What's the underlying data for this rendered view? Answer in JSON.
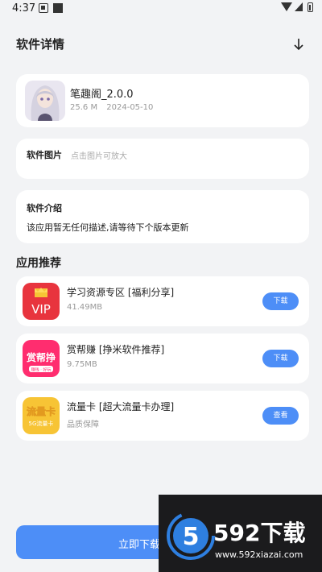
{
  "status_bar": {
    "time": "4:37"
  },
  "header": {
    "title": "软件详情",
    "download_icon": "download-arrow-icon"
  },
  "app": {
    "name": "笔趣阁_2.0.0",
    "size": "25.6 M",
    "date": "2024-05-10"
  },
  "images_section": {
    "label": "软件图片",
    "hint": "点击图片可放大"
  },
  "intro_section": {
    "label": "软件介绍",
    "text": "该应用暂无任何描述,请等待下个版本更新"
  },
  "recommend": {
    "heading": "应用推荐",
    "items": [
      {
        "name": "学习资源专区 [福利分享]",
        "sub": "41.49MB",
        "button": "下载",
        "icon": "vip-icon",
        "icon_text": "VIP"
      },
      {
        "name": "赏帮赚 [挣米软件推荐]",
        "sub": "9.75MB",
        "button": "下载",
        "icon": "shangbangzhuan-icon",
        "icon_text": "赏帮挣",
        "icon_subtext": "赚钱 · 好玩"
      },
      {
        "name": "流量卡 [超大流量卡办理]",
        "sub": "品质保障",
        "button": "查看",
        "icon": "liuliangka-icon",
        "icon_text": "流量卡",
        "icon_subtext": "5G流量卡"
      }
    ]
  },
  "bottom": {
    "download_label": "立即下载"
  },
  "watermark": {
    "brand": "592下载",
    "url": "www.592xiazai.com",
    "logo_digit": "5"
  },
  "colors": {
    "accent": "#4d8ef7",
    "background": "#f2f3f5",
    "vip_red": "#e8343e",
    "shang_pink": "#ff2d6f",
    "liuliang_yellow": "#f7c435"
  }
}
